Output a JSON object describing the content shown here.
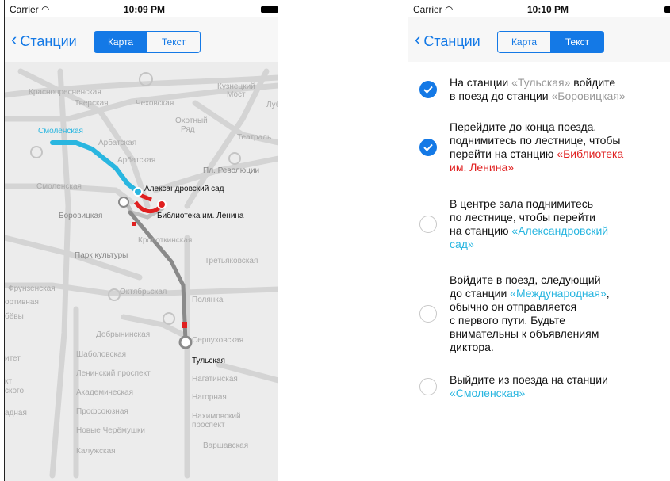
{
  "left": {
    "status": {
      "carrier": "Carrier",
      "time": "10:09 PM"
    },
    "nav": {
      "back": "Станции",
      "seg_map": "Карта",
      "seg_text": "Текст"
    },
    "map_labels": {
      "krasnopresnenskaya": "Краснопресненская",
      "tverskaya": "Тверская",
      "chekhovskaya": "Чеховская",
      "kuznetsky_most_1": "Кузнецкий",
      "kuznetsky_most_2": "Мост",
      "lub": "Луб",
      "okhotny_1": "Охотный",
      "okhotny_2": "Ряд",
      "teatralnaya": "Театраль",
      "smolenskaya_blue": "Смоленская",
      "arbatskaya_1": "Арбатская",
      "arbatskaya_2": "Арбатская",
      "pl_revolyutsii": "Пл. Революции",
      "smolenskaya_2": "Смоленская",
      "aleksandrovsky": "Александровский сад",
      "borovitskaya": "Боровицкая",
      "biblioteka": "Библиотека им. Ленина",
      "kropotkinskaya": "Кропоткинская",
      "park_kultury": "Парк культуры",
      "tretyakovskaya": "Третьяковская",
      "frunzenskaya": "Фрунзенская",
      "sportivnaya": "ортивная",
      "vorobyovy": "бёвы",
      "oktyabrskaya": "Октябрьская",
      "polyanka": "Полянка",
      "dobryninskaya": "Добрынинская",
      "serpukhovskaya": "Серпуховская",
      "universitet": "итет",
      "shabolovskaya": "Шаболовская",
      "tulskaya": "Тульская",
      "leninsky": "Ленинский проспект",
      "nagatinskaya": "Нагатинская",
      "kt": "кт",
      "skogo": "ского",
      "akademicheskaya": "Академическая",
      "nagornaya": "Нагорная",
      "zapadnaya": "адная",
      "profsoyuznaya": "Профсоюзная",
      "nakhimovsky_1": "Нахимовский",
      "nakhimovsky_2": "проспект",
      "novye_cheremushki": "Новые Черёмушки",
      "kaluzhskaya": "Калужская",
      "varshavskaya": "Варшавская"
    }
  },
  "right": {
    "status": {
      "carrier": "Carrier",
      "time": "10:10 PM"
    },
    "nav": {
      "back": "Станции",
      "seg_map": "Карта",
      "seg_text": "Текст"
    },
    "steps": [
      {
        "done": true,
        "parts": [
          {
            "t": "На станции ",
            "c": ""
          },
          {
            "t": "«Тульская»",
            "c": "gray"
          },
          {
            "t": " войдите",
            "c": ""
          },
          {
            "t": "\nв поезд до станции ",
            "c": ""
          },
          {
            "t": "«Боровицкая»",
            "c": "gray"
          }
        ]
      },
      {
        "done": true,
        "parts": [
          {
            "t": "Перейдите до конца поезда,\nподнимитесь по лестнице, чтобы\nперейти на станцию ",
            "c": ""
          },
          {
            "t": "«Библиотека\nим. Ленина»",
            "c": "red"
          }
        ]
      },
      {
        "done": false,
        "parts": [
          {
            "t": "В центре зала поднимитесь\nпо лестнице, чтобы перейти\nна станцию ",
            "c": ""
          },
          {
            "t": "«Александровский\nсад»",
            "c": "blue"
          }
        ]
      },
      {
        "done": false,
        "parts": [
          {
            "t": "Войдите в поезд, следующий\nдо станции ",
            "c": ""
          },
          {
            "t": "«Международная»",
            "c": "blue"
          },
          {
            "t": ",\nобычно он отправляется\nс первого пути. Будьте\nвнимательны к объявлениям\nдиктора.",
            "c": ""
          }
        ]
      },
      {
        "done": false,
        "parts": [
          {
            "t": "Выйдите из поезда на станции\n",
            "c": ""
          },
          {
            "t": "«Смоленская»",
            "c": "blue"
          }
        ]
      }
    ]
  },
  "colors": {
    "accent": "#1479e6",
    "route_blue": "#29b6e0",
    "route_red": "#e02020",
    "route_gray": "#999999"
  },
  "icons": {
    "back": "chevron-left-icon",
    "check": "checkmark-icon",
    "wifi": "wifi-icon",
    "battery": "battery-icon"
  }
}
